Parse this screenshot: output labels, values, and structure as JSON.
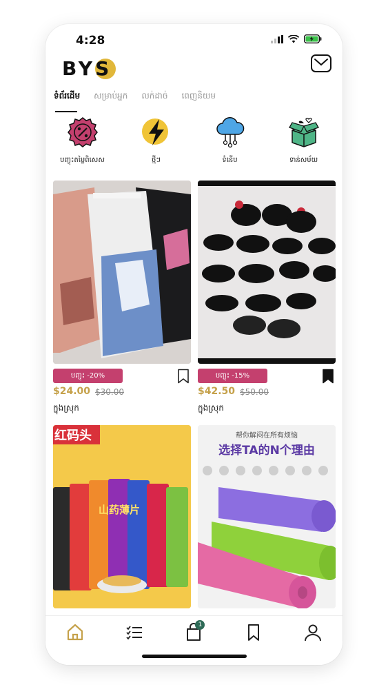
{
  "status_bar": {
    "time": "4:28"
  },
  "header": {
    "logo": "BYS",
    "inbox_icon": "envelope-icon"
  },
  "tabs": [
    {
      "label": "ទំព័រដើម"
    },
    {
      "label": "សម្រាប់អ្នក"
    },
    {
      "label": "លក់ដាច់"
    },
    {
      "label": "ពេញនិយម"
    }
  ],
  "categories": [
    {
      "label": "បញ្ចុះតម្លៃពិសេស",
      "icon": "discount-badge-icon",
      "color": "#c4406e"
    },
    {
      "label": "ថ្មីៗ",
      "icon": "lightning-icon",
      "color": "#f0c437"
    },
    {
      "label": "ទំនើប",
      "icon": "cloud-network-icon",
      "color": "#4ea6e6"
    },
    {
      "label": "ទាន់សម័យ",
      "icon": "gift-box-icon",
      "color": "#4fb587"
    }
  ],
  "products": [
    {
      "discount": "បញ្ចុះ -20%",
      "price": "$24.00",
      "old_price": "$30.00",
      "location": "ក្នុងស្រុក",
      "saved": false,
      "image_desc": "printed shorts"
    },
    {
      "discount": "បញ្ចុះ -15%",
      "price": "$42.50",
      "old_price": "$50.00",
      "location": "ក្នុងស្រុក",
      "saved": true,
      "image_desc": "sunglasses"
    },
    {
      "image_text": "红码头",
      "image_desc": "yam chips snacks",
      "chip_label": "山药薄片"
    },
    {
      "image_text_top": "帮你解闷在所有烦恼",
      "image_text_main": "选择TA的N个理由",
      "image_desc": "yoga mats"
    }
  ],
  "bottom_nav": {
    "items": [
      {
        "name": "home-icon",
        "active": true
      },
      {
        "name": "list-icon"
      },
      {
        "name": "cart-icon"
      },
      {
        "name": "bookmark-icon"
      },
      {
        "name": "profile-icon"
      }
    ],
    "cart_count": "1"
  },
  "colors": {
    "accent": "#c5a14a",
    "badge": "#c4406e",
    "cart_badge": "#2e6b57"
  }
}
